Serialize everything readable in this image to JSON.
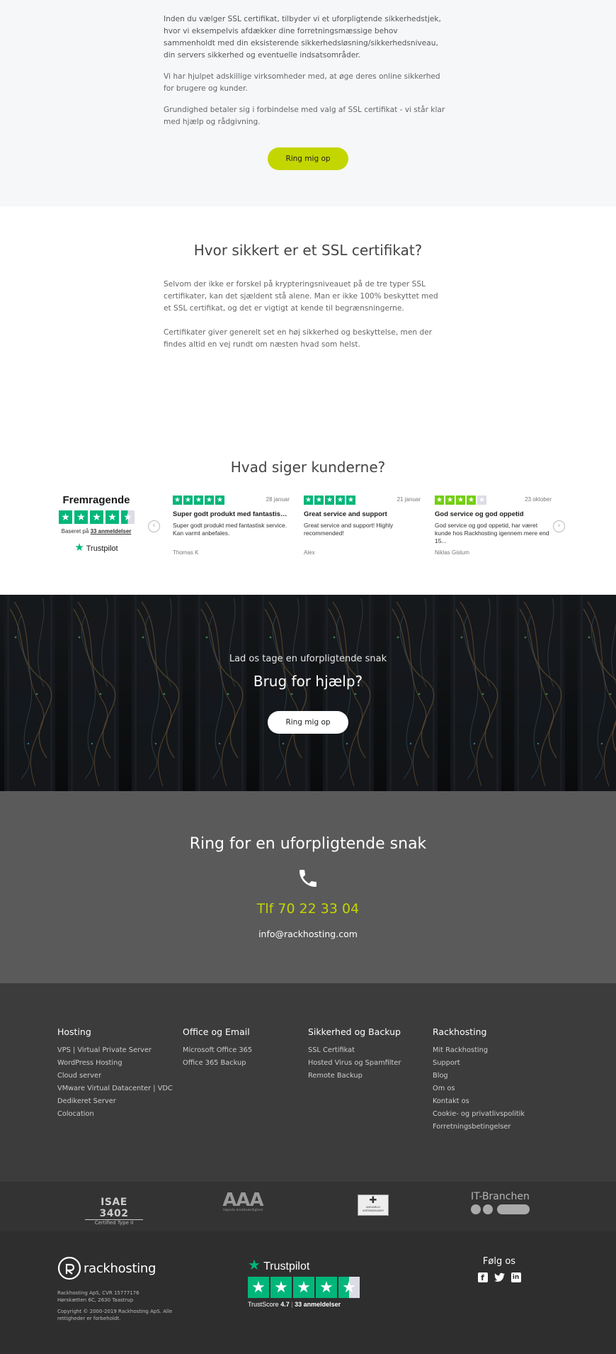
{
  "intro": {
    "paragraphs": [
      "Inden du vælger SSL certifikat, tilbyder vi et uforpligtende sikkerhedstjek, hvor vi eksempelvis afdækker dine forretningsmæssige behov sammenholdt med din eksisterende sikkerhedsløsning/sikkerhedsniveau, din servers sikkerhed og eventuelle indsatsområder.",
      "Vi har hjulpet adskillige virksomheder med, at øge deres online sikkerhed for brugere og kunder.",
      "Grundighed betaler sig i forbindelse med valg af SSL certifikat - vi står klar med hjælp og rådgivning."
    ],
    "button": "Ring mig op"
  },
  "ssl": {
    "heading": "Hvor sikkert er et SSL certifikat?",
    "paragraphs": [
      "Selvom der ikke er forskel på krypteringsniveauet på de tre typer SSL certifikater, kan det sjældent stå alene. Man er ikke 100% beskyttet med et SSL certifikat, og det er vigtigt at kende til begrænsningerne.",
      "Certifikater giver generelt set en høj sikkerhed og beskyttelse, men der findes altid en vej rundt om næsten hvad som helst."
    ]
  },
  "reviews": {
    "heading": "Hvad siger kunderne?",
    "summary": {
      "rating_word": "Fremragende",
      "stars": 4.5,
      "based_prefix": "Baseret på",
      "based_count": "33 anmeldelser",
      "brand": "Trustpilot"
    },
    "items": [
      {
        "stars": 5,
        "date": "28 januar",
        "title": "Super godt produkt med fantastisk service",
        "body": "Super godt produkt med fantastisk service. Kan varmt anbefales.",
        "author": "Thomas K"
      },
      {
        "stars": 5,
        "date": "21 januar",
        "title": "Great service and support",
        "body": "Great service and support! Highly recommended!",
        "author": "Alex"
      },
      {
        "stars": 4,
        "date": "23 oktober",
        "title": "God service og god oppetid",
        "body": "God service og god oppetid, har været kunde hos Rackhosting igennem mere end 15...",
        "author": "Niklas Gislum"
      }
    ]
  },
  "banner": {
    "subtitle": "Lad os tage en uforpligtende snak",
    "title": "Brug for hjælp?",
    "button": "Ring mig op"
  },
  "contact": {
    "heading": "Ring for en uforpligtende snak",
    "phone": "Tlf 70 22 33 04",
    "email": "info@rackhosting.com",
    "accent": "#c4d600"
  },
  "footer": {
    "columns": [
      {
        "title": "Hosting",
        "links": [
          "VPS | Virtual Private Server",
          "WordPress Hosting",
          "Cloud server",
          "VMware Virtual Datacenter | VDC",
          "Dedikeret Server",
          "Colocation"
        ]
      },
      {
        "title": "Office og Email",
        "links": [
          "Microsoft Office 365",
          "Office 365 Backup"
        ]
      },
      {
        "title": "Sikkerhed og Backup",
        "links": [
          "SSL Certifikat",
          "Hosted Virus og Spamfilter",
          "Remote Backup"
        ]
      },
      {
        "title": "Rackhosting",
        "links": [
          "Mit Rackhosting",
          "Support",
          "Blog",
          "Om os",
          "Kontakt os",
          "Cookie- og privatlivspolitik",
          "Forretningsbetingelser"
        ]
      }
    ],
    "certs": {
      "isae_top": "ISAE 3402",
      "isae_sub": "Certified Type II",
      "aaa": "AAA",
      "aaa_sub": "Højeste kreditværdighed",
      "ca_text": "ANSVARLIG KORTINDEHAVER",
      "itb": "IT-Branchen"
    },
    "brand": "rackhosting",
    "company_line1": "Rackhosting ApS, CVR 15777176",
    "company_line2": "Hørskætten 6C, 2630 Taastrup",
    "copyright": "Copyright © 2000-2019 Rackhosting ApS. Alle rettigheder er forbeholdt.",
    "trustpilot": {
      "brand": "Trustpilot",
      "stars": 4.5,
      "score_label": "TrustScore",
      "score": "4.7",
      "count": "33 anmeldelser"
    },
    "follow": "Følg os",
    "social": [
      "facebook-icon",
      "twitter-icon",
      "linkedin-icon"
    ]
  },
  "colors": {
    "lime": "#c4d600",
    "trustpilot_green": "#00b67a",
    "footer_bg": "#3c3c3c",
    "contact_bg": "#5a5a5a",
    "bottom_bg": "#2e2e2e"
  }
}
